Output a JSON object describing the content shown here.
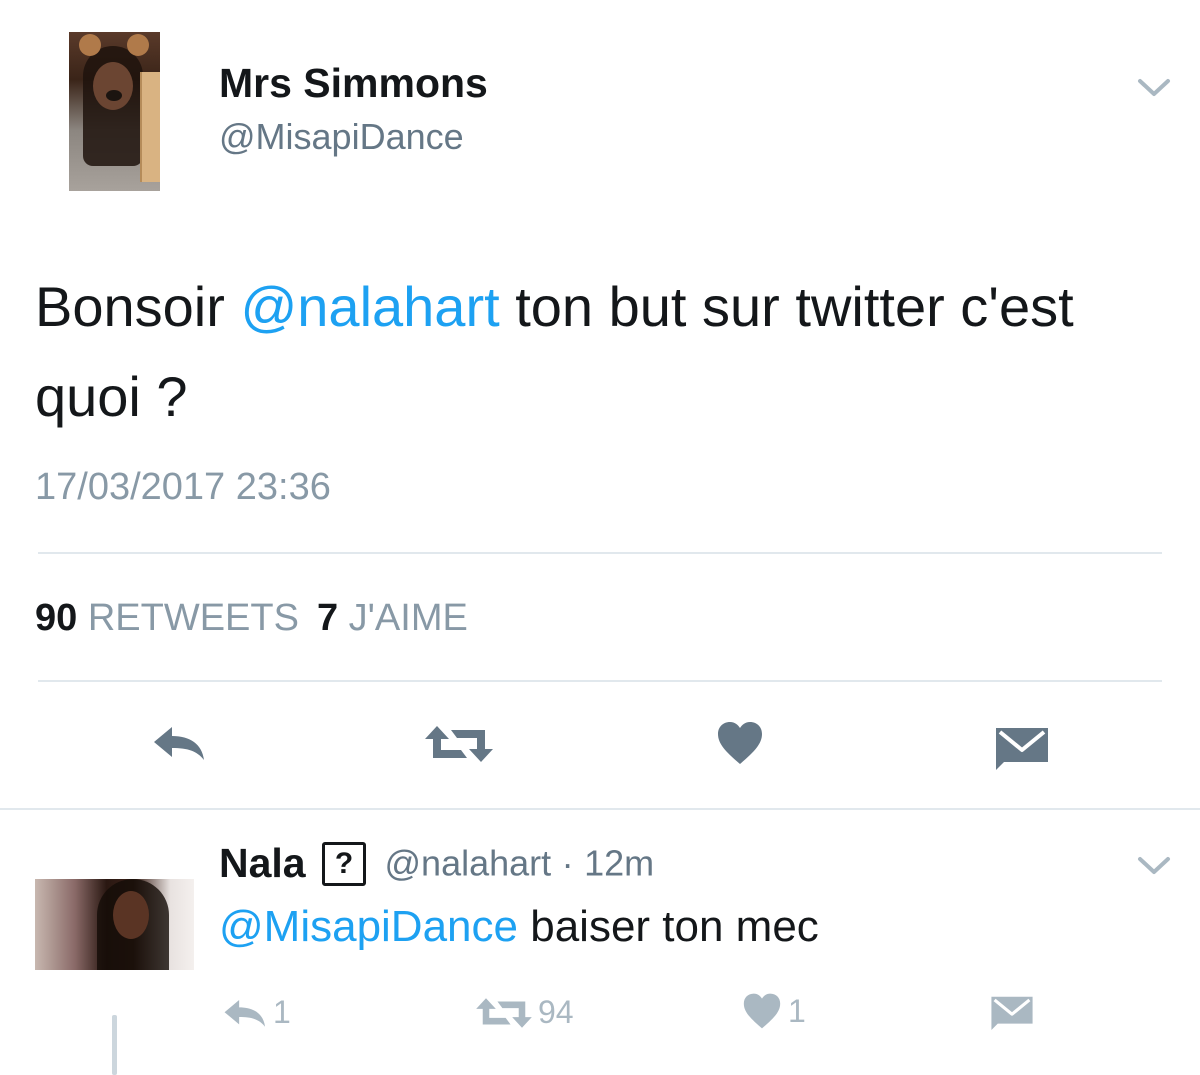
{
  "main_tweet": {
    "author": {
      "display_name": "Mrs Simmons",
      "handle": "@MisapiDance",
      "avatar": "user-photo-with-dog-filter"
    },
    "text_before_mention": "Bonsoir ",
    "mention": "@nalahart",
    "text_after_mention": " ton but sur twitter c'est quoi ?",
    "timestamp": "17/03/2017 23:36",
    "stats": {
      "retweets_count": "90",
      "retweets_label": "RETWEETS",
      "likes_count": "7",
      "likes_label": "J'AIME"
    },
    "actions": [
      "reply-icon",
      "retweet-icon",
      "heart-icon",
      "message-icon"
    ],
    "menu_icon": "chevron-down-icon"
  },
  "reply_tweet": {
    "author": {
      "display_name": "Nala",
      "badge": "?",
      "handle": "@nalahart",
      "separator": "·",
      "time": "12m",
      "avatar": "user-photo"
    },
    "mention": "@MisapiDance",
    "text": " baiser ton mec",
    "counts": {
      "replies": "1",
      "retweets": "94",
      "likes": "1"
    },
    "menu_icon": "chevron-down-icon"
  },
  "colors": {
    "link_blue": "#1da1f2",
    "icon_gray": "#657786",
    "muted_gray": "#8899a6",
    "reply_icon_gray": "#aab8c2",
    "divider": "#e1e8ed"
  }
}
